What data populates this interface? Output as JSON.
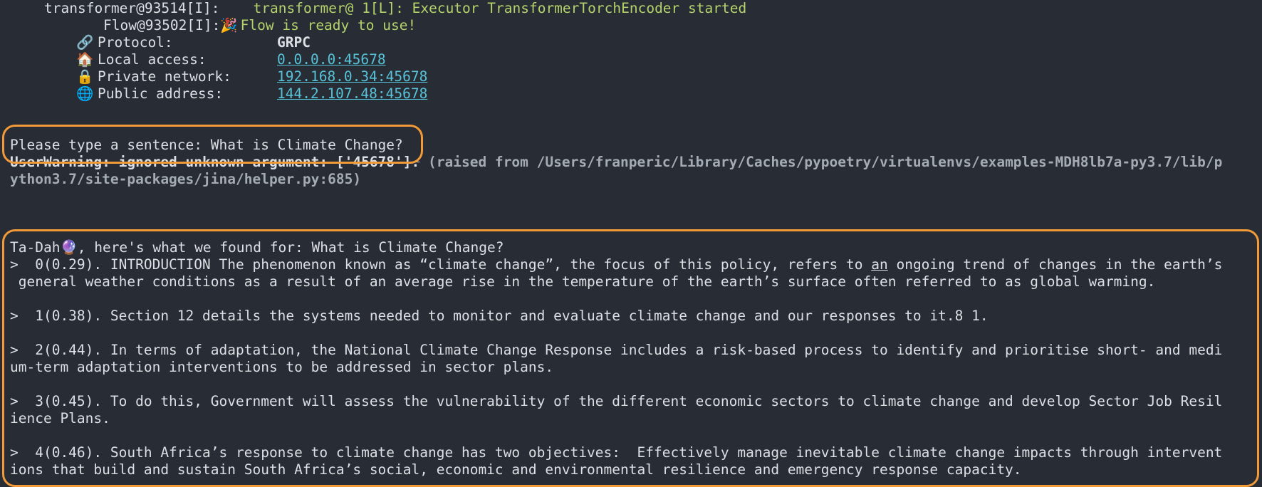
{
  "colors": {
    "background": "#282c34",
    "text": "#dcdfe4",
    "green": "#b5d36a",
    "link": "#56c3d8",
    "highlight": "#f29a38"
  },
  "header": {
    "executor_prefix": "transformer@93514[I]:",
    "executor_msg": "transformer@ 1[L]: Executor TransformerTorchEncoder started",
    "flow_prefix": "Flow@93502[I]:",
    "flow_emoji": "🎉",
    "flow_msg": "Flow is ready to use!"
  },
  "endpoints": [
    {
      "icon": "link-icon",
      "glyph": "🔗",
      "label": "Protocol:",
      "value": "GRPC",
      "is_link": false
    },
    {
      "icon": "house-icon",
      "glyph": "🏠",
      "label": "Local access:",
      "value": "0.0.0.0:45678",
      "is_link": true
    },
    {
      "icon": "lock-icon",
      "glyph": "🔒",
      "label": "Private network:",
      "value": "192.168.0.34:45678",
      "is_link": true
    },
    {
      "icon": "globe-icon",
      "glyph": "🌐",
      "label": "Public address:",
      "value": "144.2.107.48:45678",
      "is_link": true
    }
  ],
  "prompt": {
    "text": "Please type a sentence: What is Climate Change?"
  },
  "warning": {
    "struck": "UserWarning: ignored unknown argument: ['45678'].",
    "detail_line1": " (raised from /Users/franperic/Library/Caches/pypoetry/virtualenvs/examples-MDH8lb7a-py3.7/lib/p",
    "detail_line2": "ython3.7/site-packages/jina/helper.py:685)"
  },
  "results": {
    "heading_pre": "Ta-Dah",
    "heading_emoji": "🔮",
    "heading_post": ", here's what we found for: What is Climate Change?",
    "items": [
      {
        "line1_pre": ">  0(0.29). INTRODUCTION The phenomenon known as “climate change”, the focus of this policy, refers to ",
        "line1_u": "an",
        "line1_post": " ongoing trend of changes in the earth’s",
        "line2": " general weather conditions as a result of an average rise in the temperature of the earth’s surface often referred to as global warming."
      },
      {
        "line1": ">  1(0.38). Section 12 details the systems needed to monitor and evaluate climate change and our responses to it.8 1."
      },
      {
        "line1": ">  2(0.44). In terms of adaptation, the National Climate Change Response includes a risk-based process to identify and prioritise short- and medi",
        "line2": "um-term adaptation interventions to be addressed in sector plans."
      },
      {
        "line1": ">  3(0.45). To do this, Government will assess the vulnerability of the different economic sectors to climate change and develop Sector Job Resil",
        "line2": "ience Plans."
      },
      {
        "line1": ">  4(0.46). South Africa’s response to climate change has two objectives:  Effectively manage inevitable climate change impacts through intervent",
        "line2": "ions that build and sustain South Africa’s social, economic and environmental resilience and emergency response capacity."
      }
    ]
  }
}
